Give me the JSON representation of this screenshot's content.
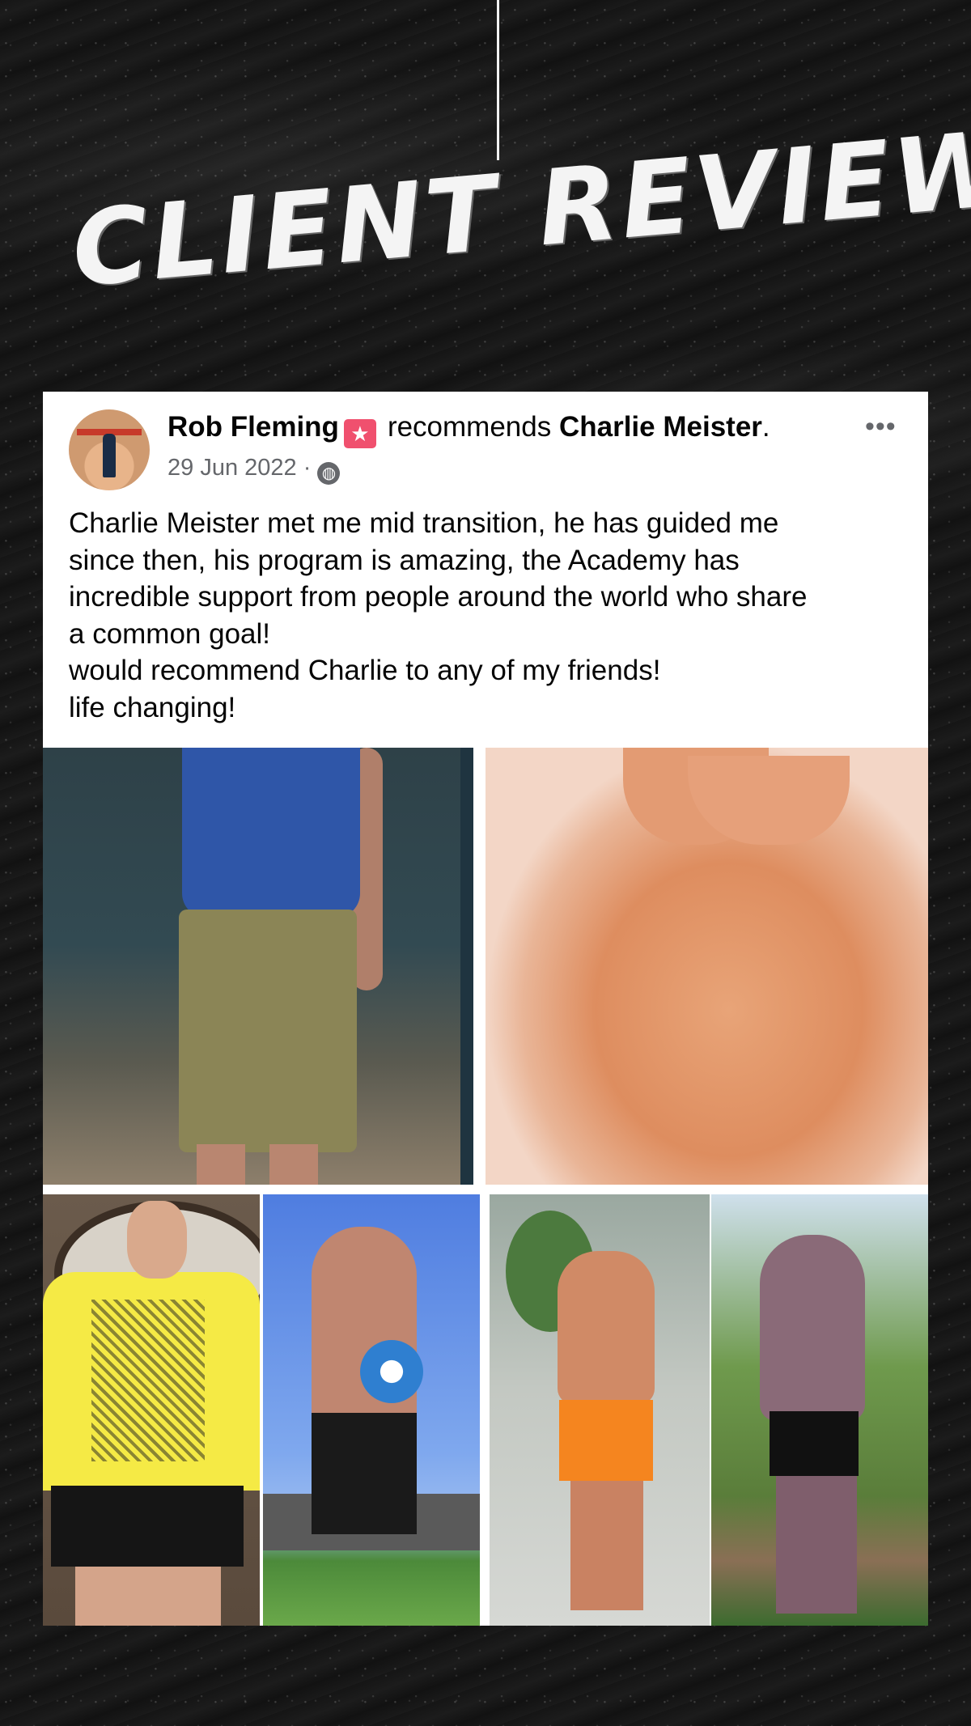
{
  "header": {
    "title": "CLIENT REVIEWS"
  },
  "post": {
    "author": "Rob Fleming",
    "action": "recommends",
    "target": "Charlie Meister",
    "target_suffix": ".",
    "date": "29 Jun 2022",
    "date_separator": "·",
    "audience_icon": "globe-icon",
    "more_icon": "more-options-icon",
    "body_lines": [
      "Charlie Meister met me mid transition, he has guided me",
      "since then, his program is amazing, the Academy has",
      "incredible support from people around the world who share",
      "a common goal!",
      "would recommend Charlie to any of my friends!",
      "life changing!"
    ]
  },
  "colors": {
    "background": "#141414",
    "card": "#ffffff",
    "text": "#050505",
    "meta": "#65676b",
    "badge": "#f0506e"
  }
}
